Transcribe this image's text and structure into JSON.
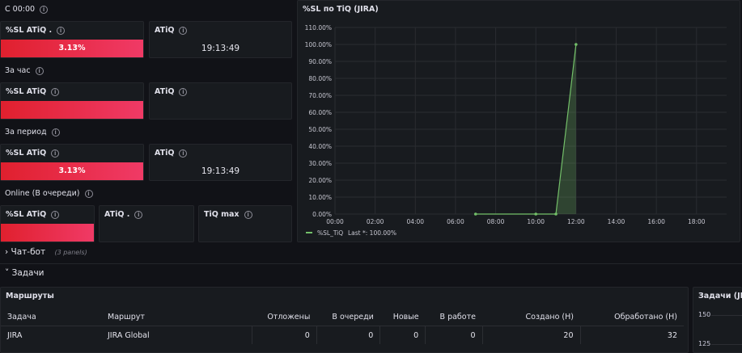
{
  "sections": {
    "since_midnight": "С 00:00",
    "per_hour": "За час",
    "per_period": "За период",
    "online": "Online (В очереди)"
  },
  "row1": {
    "sl_title": "%SL ATiQ .",
    "sl_value": "3.13%",
    "sl_level": 1.0,
    "atiq_title": "ATiQ",
    "atiq_value": "19:13:49"
  },
  "row2": {
    "sl_title": "%SL ATiQ",
    "sl_level": 1.0,
    "atiq_title": "ATiQ"
  },
  "row3": {
    "sl_title": "%SL ATiQ",
    "sl_value": "3.13%",
    "sl_level": 1.0,
    "atiq_title": "ATiQ",
    "atiq_value": "19:13:49"
  },
  "row4": {
    "sl_title": "%SL ATiQ",
    "sl_level": 1.0,
    "atiq_title": "ATiQ .",
    "tiq_title": "TiQ max"
  },
  "chatbot": {
    "title": "Чат-бот",
    "panels": "(3 panels)"
  },
  "tasks": {
    "title": "Задачи"
  },
  "routes": {
    "title": "Маршруты",
    "columns": [
      "Задача",
      "Маршрут",
      "Отложены",
      "В очереди",
      "Новые",
      "В работе",
      "Создано (Н)",
      "Обработано (Н)"
    ],
    "rows": [
      [
        "JIRA",
        "JIRA Global",
        "0",
        "0",
        "0",
        "0",
        "20",
        "32"
      ]
    ]
  },
  "tasks_jira_panel": {
    "title": "Задачи (JIR",
    "ticks": [
      "150",
      "125"
    ]
  },
  "chart_data": {
    "type": "area",
    "title": "%SL по TiQ (JIRA)",
    "x_ticks": [
      "00:00",
      "02:00",
      "04:00",
      "06:00",
      "08:00",
      "10:00",
      "12:00",
      "14:00",
      "16:00",
      "18:00"
    ],
    "y_ticks": [
      "0.00%",
      "10.00%",
      "20.00%",
      "30.00%",
      "40.00%",
      "50.00%",
      "60.00%",
      "70.00%",
      "80.00%",
      "90.00%",
      "100.00%",
      "110.00%"
    ],
    "xlim": [
      0,
      19.5
    ],
    "ylim": [
      0,
      110
    ],
    "series": [
      {
        "name": "%SL_TiQ",
        "legend_text": "Last *: 100.00%",
        "color": "#73bf69",
        "x": [
          7,
          10,
          11,
          12
        ],
        "y": [
          0,
          0,
          0,
          100
        ]
      }
    ],
    "grid": true,
    "legend": "bottom-left"
  },
  "colors": {
    "accent_red": "#e0202e",
    "series_green": "#73bf69",
    "panel_bg": "#181b1f"
  }
}
